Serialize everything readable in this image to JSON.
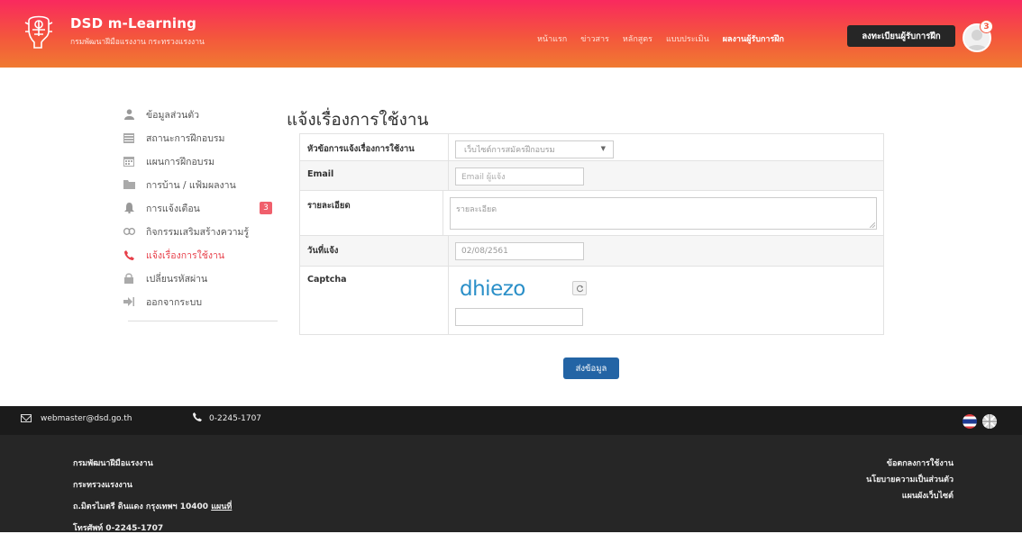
{
  "header": {
    "brand_name": "DSD m-Learning",
    "brand_sub": "กรมพัฒนาฝีมือแรงงาน กระทรวงแรงงาน",
    "nav": [
      "หน้าแรก",
      "ข่าวสาร",
      "หลักสูตร",
      "แบบประเมิน",
      "ผลงานผู้รับการฝึก"
    ],
    "register_label": "ลงทะเบียนผู้รับการฝึก",
    "notification_count": "3"
  },
  "sidebar": {
    "items": [
      {
        "label": "ข้อมูลส่วนตัว",
        "icon": "user-icon"
      },
      {
        "label": "สถานะการฝึกอบรม",
        "icon": "list-icon"
      },
      {
        "label": "แผนการฝึกอบรม",
        "icon": "calendar-icon"
      },
      {
        "label": "การบ้าน / แฟ้มผลงาน",
        "icon": "folder-icon"
      },
      {
        "label": "การแจ้งเตือน",
        "icon": "bell-icon",
        "badge": "3"
      },
      {
        "label": "กิจกรรมเสริมสร้างความรู้",
        "icon": "link-icon"
      },
      {
        "label": "แจ้งเรื่องการใช้งาน",
        "icon": "phone-icon",
        "active": true
      },
      {
        "label": "เปลี่ยนรหัสผ่าน",
        "icon": "lock-icon"
      },
      {
        "label": "ออกจากระบบ",
        "icon": "sign-out-icon"
      }
    ]
  },
  "main": {
    "title": "แจ้งเรื่องการใช้งาน",
    "form": {
      "topic_label": "หัวข้อการแจ้งเรื่องการใช้งาน",
      "topic_value": "เว็บไซต์การสมัครฝึกอบรม",
      "email_label": "Email",
      "email_placeholder": "Email ผู้แจ้ง",
      "detail_label": "รายละเอียด",
      "detail_placeholder": "รายละเอียด",
      "date_label": "วันที่แจ้ง",
      "date_value": "02/08/2561",
      "captcha_label": "Captcha",
      "captcha_text": "dhiezo",
      "submit_label": "ส่งข้อมูล"
    }
  },
  "footer": {
    "email": "webmaster@dsd.go.th",
    "phone": "0-2245-1707",
    "org_line1": "กรมพัฒนาฝีมือแรงงาน",
    "org_line2": "กระทรวงแรงงาน",
    "address": "ถ.มิตรไมตรี ดินแดง กรุงเทพฯ 10400",
    "map_link": "แผนที่",
    "tel_line": "โทรศัพท์ 0-2245-1707",
    "right_links": [
      "ข้อตกลงการใช้งาน",
      "นโยบายความเป็นส่วนตัว",
      "แผนผังเว็บไซต์"
    ]
  },
  "colors": {
    "header_gradient_start": "#f9295e",
    "header_gradient_end": "#f07a31",
    "active_item": "#e7404a",
    "submit_button": "#2364a5",
    "captcha_text": "#2a8fc8",
    "footer_bar": "#1b1b1b",
    "footer_bottom": "#262626"
  }
}
